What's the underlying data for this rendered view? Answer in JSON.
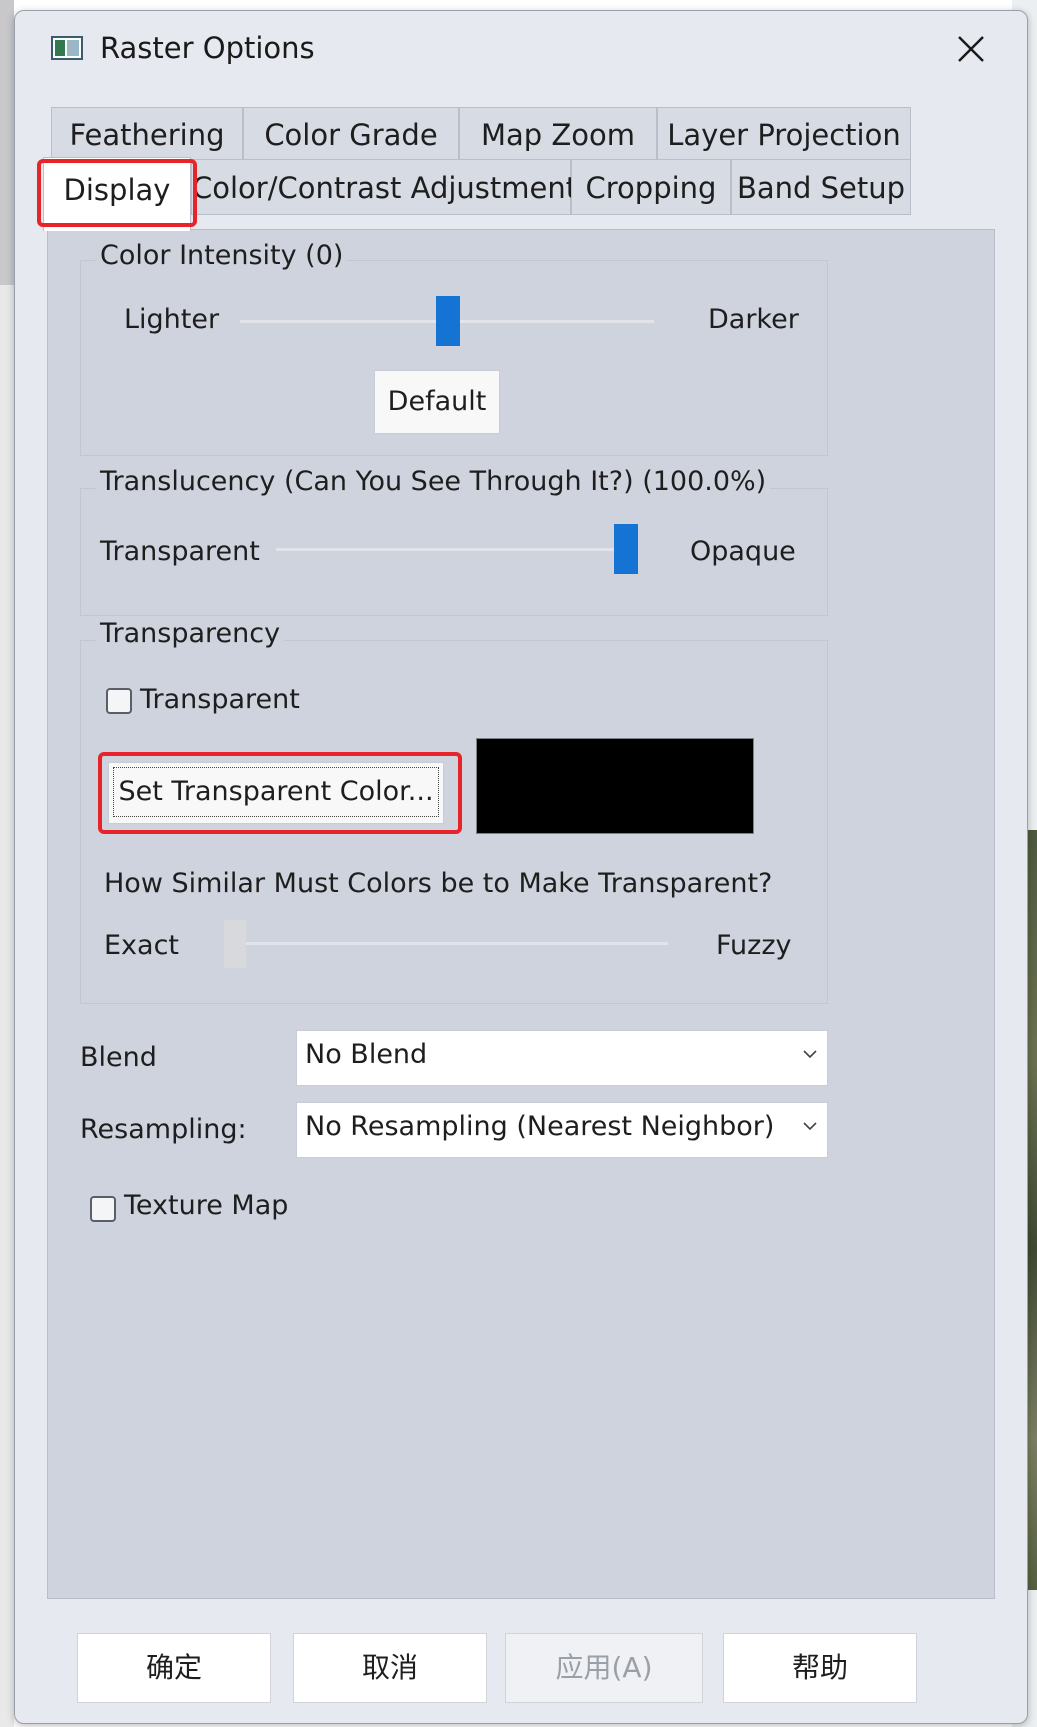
{
  "window": {
    "title": "Raster Options"
  },
  "tabs_row1": [
    "Feathering",
    "Color Grade",
    "Map Zoom",
    "Layer Projection"
  ],
  "tabs_row2": [
    "Display",
    "Color/Contrast Adjustment",
    "Cropping",
    "Band Setup"
  ],
  "active_tab": "Display",
  "color_intensity": {
    "title": "Color Intensity (0)",
    "left_label": "Lighter",
    "right_label": "Darker",
    "value_fraction": 0.5,
    "default_button": "Default"
  },
  "translucency": {
    "title": "Translucency (Can You See Through It?) (100.0%)",
    "left_label": "Transparent",
    "right_label": "Opaque",
    "value_fraction": 1.0
  },
  "transparency": {
    "title": "Transparency",
    "checkbox_label": "Transparent",
    "checked": false,
    "set_color_button": "Set Transparent Color...",
    "color_swatch": "#000000",
    "similarity_label": "How Similar Must Colors be to Make Transparent?",
    "left_label": "Exact",
    "right_label": "Fuzzy",
    "value_fraction": 0.0
  },
  "blend": {
    "label": "Blend",
    "value": "No Blend"
  },
  "resampling": {
    "label": "Resampling:",
    "value": "No Resampling (Nearest Neighbor)"
  },
  "texture_map": {
    "label": "Texture Map",
    "checked": false
  },
  "footer": {
    "ok": "确定",
    "cancel": "取消",
    "apply": "应用(A)",
    "help": "帮助"
  },
  "colors": {
    "accent": "#1573d3",
    "highlight": "#e8242b"
  }
}
